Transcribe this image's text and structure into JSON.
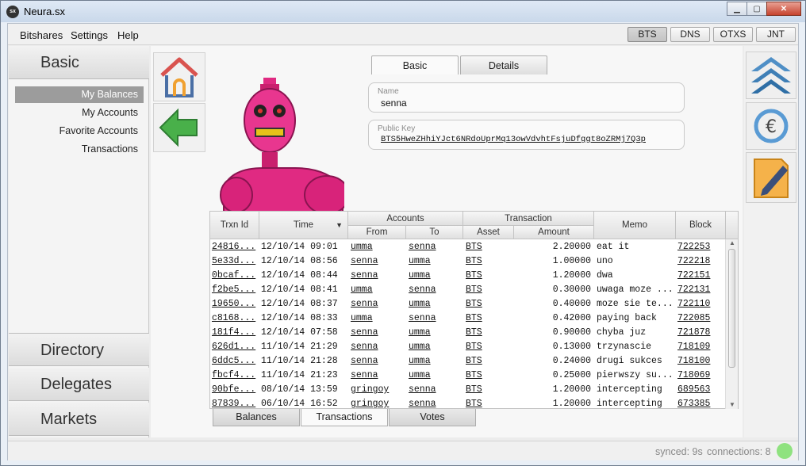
{
  "window": {
    "title": "Neura.sx",
    "app_icon_text": "sx"
  },
  "menu": [
    "Bitshares",
    "Settings",
    "Help"
  ],
  "currency_tabs": [
    {
      "label": "BTS",
      "active": true
    },
    {
      "label": "DNS",
      "active": false
    },
    {
      "label": "OTXS",
      "active": false
    },
    {
      "label": "JNT",
      "active": false
    }
  ],
  "sidebar": {
    "basic_title": "Basic",
    "items": [
      {
        "label": "My Balances",
        "active": true
      },
      {
        "label": "My Accounts",
        "active": false
      },
      {
        "label": "Favorite Accounts",
        "active": false
      },
      {
        "label": "Transactions",
        "active": false
      }
    ],
    "sections": [
      "Directory",
      "Delegates",
      "Markets"
    ]
  },
  "top_tabs": [
    {
      "label": "Basic",
      "active": true
    },
    {
      "label": "Details",
      "active": false
    }
  ],
  "name_field": {
    "label": "Name",
    "value": "senna"
  },
  "public_key_field": {
    "label": "Public Key",
    "value": "BTS5HweZHhiYJct6NRdoUprMq13owVdvhtFsjuDfggt8oZRMj7Q3p"
  },
  "table": {
    "headers": {
      "trxn_id": "Trxn Id",
      "time": "Time",
      "accounts": "Accounts",
      "from": "From",
      "to": "To",
      "transaction": "Transaction",
      "asset": "Asset",
      "amount": "Amount",
      "memo": "Memo",
      "block": "Block"
    },
    "rows": [
      {
        "id": "24816...",
        "time": "12/10/14 09:01",
        "from": "umma",
        "to": "senna",
        "asset": "BTS",
        "amount": "2.20000",
        "memo": "eat it",
        "block": "722253"
      },
      {
        "id": "5e33d...",
        "time": "12/10/14 08:56",
        "from": "senna",
        "to": "umma",
        "asset": "BTS",
        "amount": "1.00000",
        "memo": "uno",
        "block": "722218"
      },
      {
        "id": "0bcaf...",
        "time": "12/10/14 08:44",
        "from": "senna",
        "to": "umma",
        "asset": "BTS",
        "amount": "1.20000",
        "memo": "dwa",
        "block": "722151"
      },
      {
        "id": "f2be5...",
        "time": "12/10/14 08:41",
        "from": "umma",
        "to": "senna",
        "asset": "BTS",
        "amount": "0.30000",
        "memo": "uwaga moze ...",
        "block": "722131"
      },
      {
        "id": "19650...",
        "time": "12/10/14 08:37",
        "from": "senna",
        "to": "umma",
        "asset": "BTS",
        "amount": "0.40000",
        "memo": "moze sie te...",
        "block": "722110"
      },
      {
        "id": "c8168...",
        "time": "12/10/14 08:33",
        "from": "umma",
        "to": "senna",
        "asset": "BTS",
        "amount": "0.42000",
        "memo": "paying back",
        "block": "722085"
      },
      {
        "id": "181f4...",
        "time": "12/10/14 07:58",
        "from": "senna",
        "to": "umma",
        "asset": "BTS",
        "amount": "0.90000",
        "memo": "chyba juz",
        "block": "721878"
      },
      {
        "id": "626d1...",
        "time": "11/10/14 21:29",
        "from": "senna",
        "to": "umma",
        "asset": "BTS",
        "amount": "0.13000",
        "memo": "trzynascie",
        "block": "718109"
      },
      {
        "id": "6ddc5...",
        "time": "11/10/14 21:28",
        "from": "senna",
        "to": "umma",
        "asset": "BTS",
        "amount": "0.24000",
        "memo": "drugi sukces",
        "block": "718100"
      },
      {
        "id": "fbcf4...",
        "time": "11/10/14 21:23",
        "from": "senna",
        "to": "umma",
        "asset": "BTS",
        "amount": "0.25000",
        "memo": "pierwszy su...",
        "block": "718069"
      },
      {
        "id": "90bfe...",
        "time": "08/10/14 13:59",
        "from": "gringoy",
        "to": "senna",
        "asset": "BTS",
        "amount": "1.20000",
        "memo": "intercepting",
        "block": "689563"
      },
      {
        "id": "87839...",
        "time": "06/10/14 16:52",
        "from": "gringoy",
        "to": "senna",
        "asset": "BTS",
        "amount": "1.20000",
        "memo": "intercepting",
        "block": "673385"
      }
    ]
  },
  "bottom_tabs": [
    {
      "label": "Balances",
      "active": false
    },
    {
      "label": "Transactions",
      "active": true
    },
    {
      "label": "Votes",
      "active": false
    }
  ],
  "status": {
    "synced": "synced: 9s",
    "connections": "connections: 8",
    "status_color": "#8fe27f"
  },
  "icons": [
    "home-icon",
    "back-arrow-icon",
    "collapse-up-icon",
    "currency-exchange-icon",
    "edit-note-icon",
    "robot-avatar"
  ]
}
